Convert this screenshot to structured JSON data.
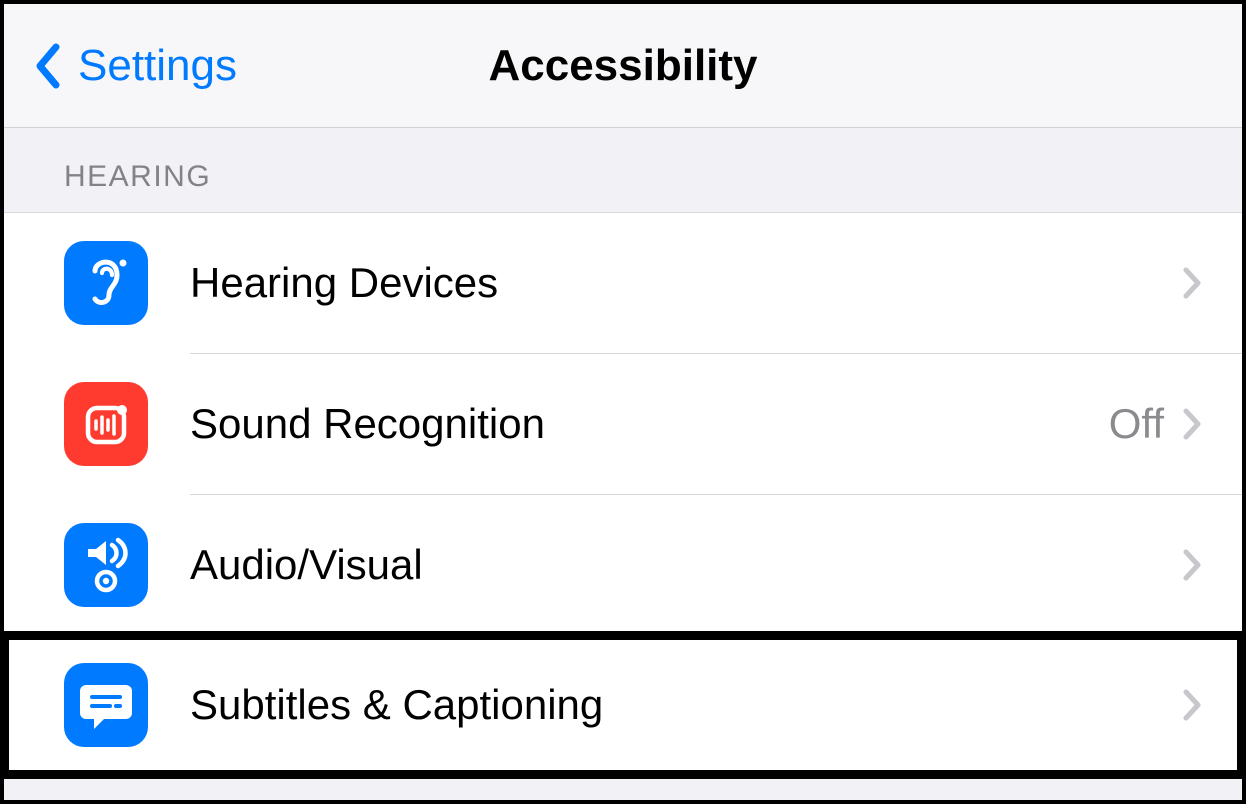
{
  "navbar": {
    "back_label": "Settings",
    "title": "Accessibility"
  },
  "section": {
    "header": "HEARING"
  },
  "rows": {
    "hearing_devices": {
      "label": "Hearing Devices"
    },
    "sound_recognition": {
      "label": "Sound Recognition",
      "detail": "Off"
    },
    "audio_visual": {
      "label": "Audio/Visual"
    },
    "subtitles_captioning": {
      "label": "Subtitles & Captioning"
    }
  }
}
